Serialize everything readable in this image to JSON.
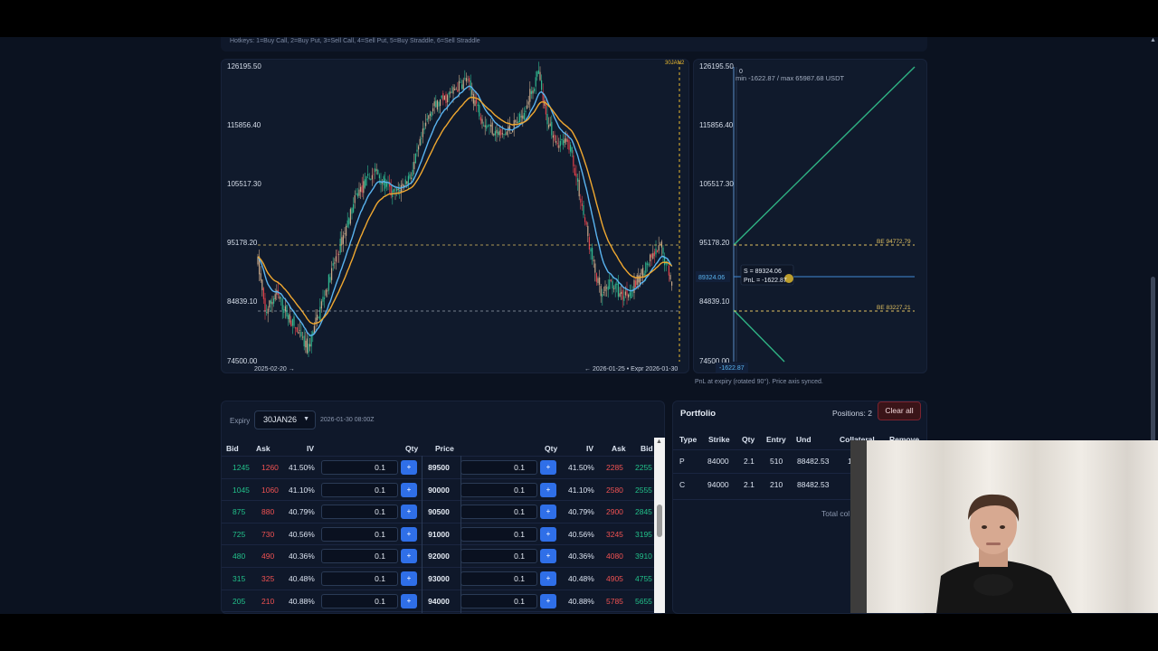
{
  "hotkeys": "Hotkeys: 1=Buy Call, 2=Buy Put, 3=Sell Call, 4=Sell Put, 5=Buy Straddle, 6=Sell Straddle",
  "price_chart": {
    "y_ticks": [
      "126195.50",
      "115856.40",
      "105517.30",
      "95178.20",
      "84839.10",
      "74500.00"
    ],
    "x_start": "2025-02-20 →",
    "x_end": "← 2026-01-25 • Expr 2026-01-30",
    "expiry_marker": "30JAN2",
    "colors": {
      "up": "#c8a888",
      "down": "#e0404a",
      "teal": "#30b890",
      "ema_fast": "#5ab4f0",
      "ema_slow": "#f0a830",
      "breakeven": "#e0c060"
    },
    "breakeven_levels": [
      94772.79,
      83227.21
    ]
  },
  "pnl_chart": {
    "y_ticks": [
      "126195.50",
      "115856.40",
      "105517.30",
      "95178.20",
      "84839.10",
      "74500.00"
    ],
    "top_zero": "0",
    "minmax": "min -1622.87 / max 65987.68 USDT",
    "be_upper": "BE 94772.79",
    "be_lower": "BE 83227.21",
    "spot_label": "89324.06",
    "tooltip_s": "S = 89324.06",
    "tooltip_pnl": "PnL = -1622.87",
    "bottom_pnl": "-1622.87"
  },
  "pnl_caption": "PnL at expiry (rotated 90°). Price axis synced.",
  "chain": {
    "expiry_label": "Expiry",
    "expiry_value": "30JAN26",
    "expiry_time": "2026-01-30 08:00Z",
    "headers": {
      "bid": "Bid",
      "ask": "Ask",
      "iv": "IV",
      "qty": "Qty",
      "price": "Price",
      "qty2": "Qty",
      "iv2": "IV",
      "ask2": "Ask",
      "bid2": "Bid"
    },
    "rows": [
      {
        "put_bid": "1245",
        "put_ask": "1260",
        "put_iv": "41.50%",
        "put_qty": "0.1",
        "strike": "89500",
        "call_qty": "0.1",
        "call_iv": "41.50%",
        "call_ask": "2285",
        "call_bid": "2255"
      },
      {
        "put_bid": "1045",
        "put_ask": "1060",
        "put_iv": "41.10%",
        "put_qty": "0.1",
        "strike": "90000",
        "call_qty": "0.1",
        "call_iv": "41.10%",
        "call_ask": "2580",
        "call_bid": "2555"
      },
      {
        "put_bid": "875",
        "put_ask": "880",
        "put_iv": "40.79%",
        "put_qty": "0.1",
        "strike": "90500",
        "call_qty": "0.1",
        "call_iv": "40.79%",
        "call_ask": "2900",
        "call_bid": "2845"
      },
      {
        "put_bid": "725",
        "put_ask": "730",
        "put_iv": "40.56%",
        "put_qty": "0.1",
        "strike": "91000",
        "call_qty": "0.1",
        "call_iv": "40.56%",
        "call_ask": "3245",
        "call_bid": "3195"
      },
      {
        "put_bid": "480",
        "put_ask": "490",
        "put_iv": "40.36%",
        "put_qty": "0.1",
        "strike": "92000",
        "call_qty": "0.1",
        "call_iv": "40.36%",
        "call_ask": "4080",
        "call_bid": "3910"
      },
      {
        "put_bid": "315",
        "put_ask": "325",
        "put_iv": "40.48%",
        "put_qty": "0.1",
        "strike": "93000",
        "call_qty": "0.1",
        "call_iv": "40.48%",
        "call_ask": "4905",
        "call_bid": "4755"
      },
      {
        "put_bid": "205",
        "put_ask": "210",
        "put_iv": "40.88%",
        "put_qty": "0.1",
        "strike": "94000",
        "call_qty": "0.1",
        "call_iv": "40.88%",
        "call_ask": "5785",
        "call_bid": "5655"
      }
    ]
  },
  "portfolio": {
    "title": "Portfolio",
    "positions": "Positions: 2",
    "clear_label": "Clear all",
    "headers": {
      "type": "Type",
      "strike": "Strike",
      "qty": "Qty",
      "entry": "Entry",
      "und": "Und",
      "collateral": "Collateral",
      "remove": "Remove"
    },
    "rows": [
      {
        "type": "P",
        "strike": "84000",
        "qty": "2.1",
        "entry": "510",
        "und": "88482.53",
        "collateral": "1"
      },
      {
        "type": "C",
        "strike": "94000",
        "qty": "2.1",
        "entry": "210",
        "und": "88482.53",
        "collateral": ""
      }
    ],
    "total": "Total col"
  }
}
